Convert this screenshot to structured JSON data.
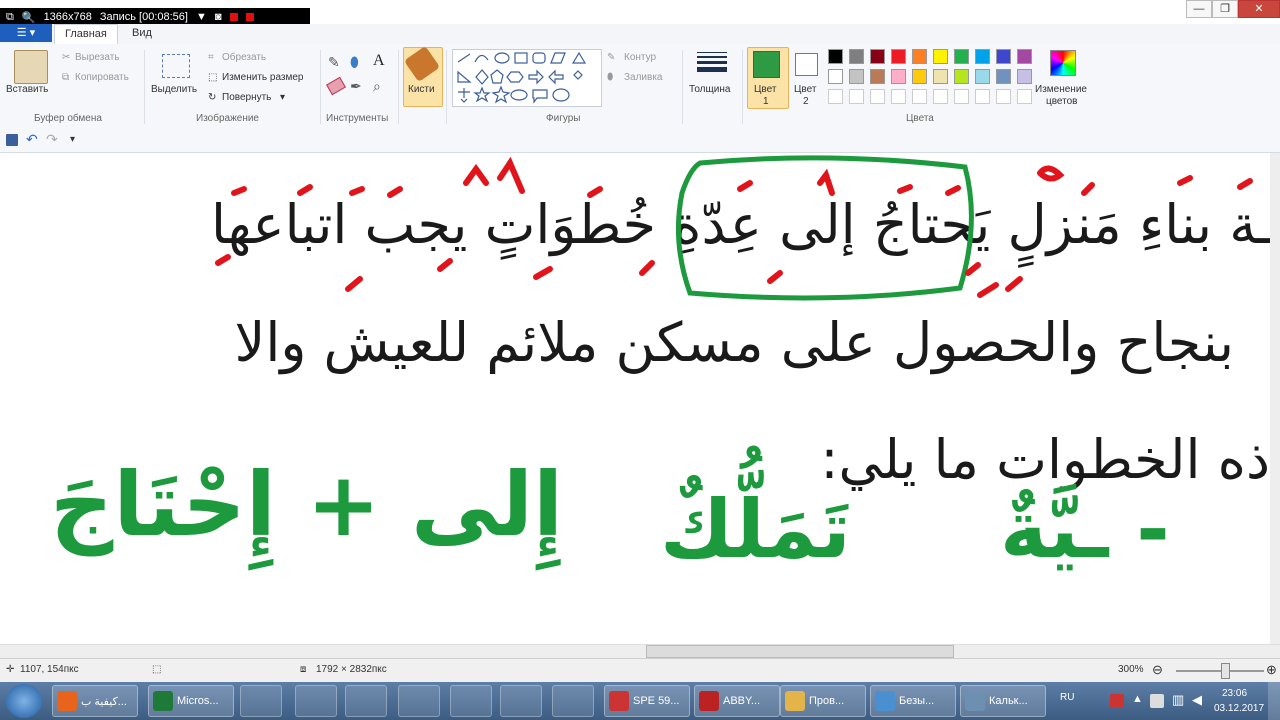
{
  "recorder": {
    "resolution": "1366x768",
    "record_label": "Запись [00:08:56]"
  },
  "window": {
    "min": "—",
    "max": "❐",
    "close": "✕"
  },
  "tabs": {
    "home": "Главная",
    "view": "Вид"
  },
  "ribbon": {
    "clipboard": {
      "paste": "Вставить",
      "cut": "Вырезать",
      "copy": "Копировать",
      "label": "Буфер обмена"
    },
    "image": {
      "select": "Выделить",
      "crop": "Обрезать",
      "resize": "Изменить размер",
      "rotate": "Повернуть",
      "label": "Изображение"
    },
    "tools": {
      "label": "Инструменты"
    },
    "brushes": {
      "label": "Кисти"
    },
    "shapes": {
      "outline": "Контур",
      "fill": "Заливка",
      "label": "Фигуры"
    },
    "size": {
      "label": "Толщина"
    },
    "color1": {
      "label_a": "Цвет",
      "label_b": "1",
      "color": "#2e9a44"
    },
    "color2": {
      "label_a": "Цвет",
      "label_b": "2",
      "color": "#ffffff"
    },
    "colors": {
      "label": "Цвета",
      "edit_a": "Изменение",
      "edit_b": "цветов"
    },
    "palette_row1": [
      "#000000",
      "#7f7f7f",
      "#880015",
      "#ed1c24",
      "#ff7f27",
      "#fff200",
      "#22b14c",
      "#00a2e8",
      "#3f48cc",
      "#a349a4"
    ],
    "palette_row2": [
      "#ffffff",
      "#c3c3c3",
      "#b97a57",
      "#ffaec9",
      "#ffc90e",
      "#efe4b0",
      "#b5e61d",
      "#99d9ea",
      "#7092be",
      "#c8bfe7"
    ]
  },
  "canvas": {
    "line1": "ـة بناءِ مَنزلٍ يَحتاجُ إلى عِدّةِ خُطوَاتٍ يجب اتباعها",
    "line2": "بنجاح والحصول على مسكن ملائم للعيش والا",
    "line3": "ذه الخطوات ما يلي:",
    "hw_left": "إِلى + إِحْتَاجَ",
    "hw_mid": "تَمَلُّكٌ",
    "hw_right": "- ـيَّةٌ"
  },
  "status": {
    "cursor": "1107, 154пкс",
    "size": "1792 × 2832пкс",
    "zoom": "300%"
  },
  "taskbar": {
    "items": [
      {
        "label": "كيفية ب...",
        "color": "#e8641c"
      },
      {
        "label": "Micros...",
        "color": "#1f7a3a"
      },
      {
        "label": "SPE 59...",
        "color": "#c33"
      },
      {
        "label": "ABBY...",
        "color": "#b22"
      },
      {
        "label": "Пров...",
        "color": "#e3b44a"
      },
      {
        "label": "Безы...",
        "color": "#4a8fd0"
      },
      {
        "label": "Кальк...",
        "color": "#6d8fb0"
      }
    ],
    "lang": "RU",
    "time": "23:06",
    "date": "03.12.2017"
  }
}
